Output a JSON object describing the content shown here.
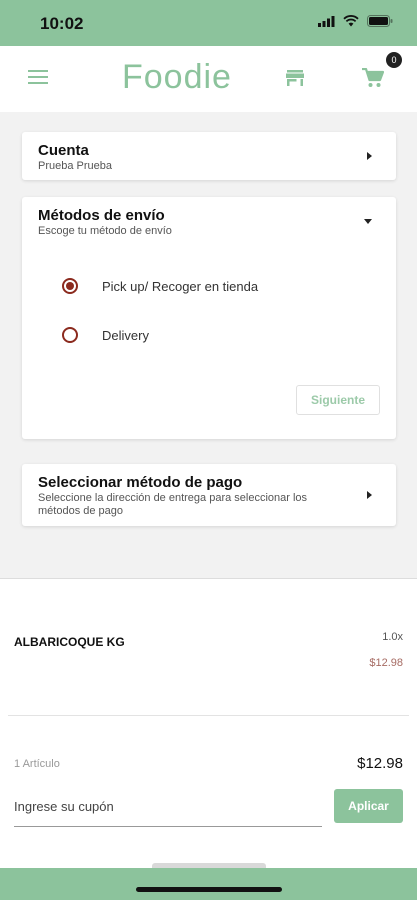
{
  "status": {
    "time": "10:02"
  },
  "header": {
    "brand": "Foodie",
    "cart_count": "0"
  },
  "account": {
    "title": "Cuenta",
    "subtitle": "Prueba Prueba"
  },
  "shipping": {
    "title": "Métodos de envío",
    "subtitle": "Escoge tu método de envío",
    "options": [
      {
        "label": "Pick up/ Recoger en tienda",
        "selected": true
      },
      {
        "label": "Delivery",
        "selected": false
      }
    ],
    "next_label": "Siguiente"
  },
  "payment": {
    "title": "Seleccionar método de pago",
    "subtitle": "Seleccione la dirección de entrega para seleccionar los métodos de pago"
  },
  "cart": {
    "items": [
      {
        "name": "ALBARICOQUE KG",
        "qty": "1.0x",
        "price": "$12.98"
      }
    ],
    "count_label": "1 Artículo",
    "total": "$12.98",
    "coupon_placeholder": "Ingrese su cupón",
    "apply_label": "Aplicar"
  },
  "colors": {
    "brand": "#8cc39c",
    "radio": "#8b2a1e",
    "item_price": "#a66b63"
  }
}
